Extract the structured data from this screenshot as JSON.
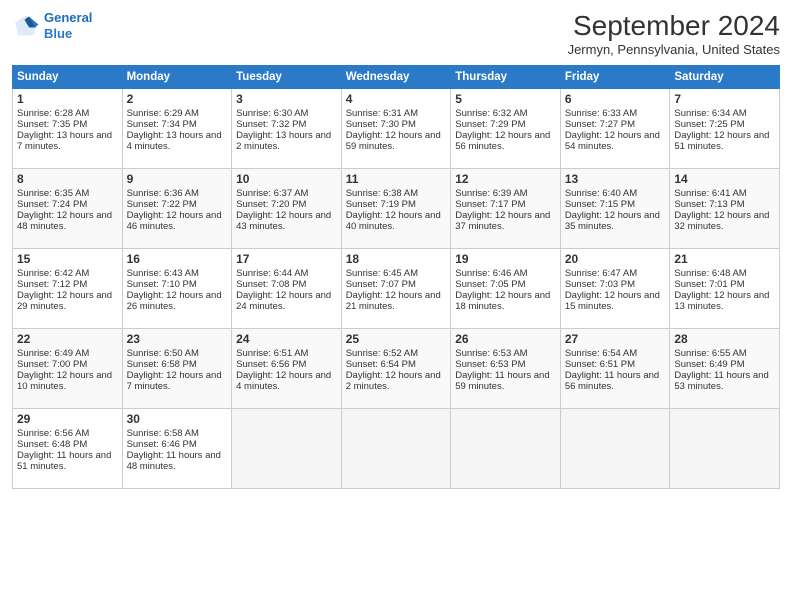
{
  "header": {
    "logo_line1": "General",
    "logo_line2": "Blue",
    "month_title": "September 2024",
    "subtitle": "Jermyn, Pennsylvania, United States"
  },
  "days_of_week": [
    "Sunday",
    "Monday",
    "Tuesday",
    "Wednesday",
    "Thursday",
    "Friday",
    "Saturday"
  ],
  "weeks": [
    [
      {
        "num": "1",
        "rise": "6:28 AM",
        "set": "7:35 PM",
        "daylight": "13 hours and 7 minutes."
      },
      {
        "num": "2",
        "rise": "6:29 AM",
        "set": "7:34 PM",
        "daylight": "13 hours and 4 minutes."
      },
      {
        "num": "3",
        "rise": "6:30 AM",
        "set": "7:32 PM",
        "daylight": "13 hours and 2 minutes."
      },
      {
        "num": "4",
        "rise": "6:31 AM",
        "set": "7:30 PM",
        "daylight": "12 hours and 59 minutes."
      },
      {
        "num": "5",
        "rise": "6:32 AM",
        "set": "7:29 PM",
        "daylight": "12 hours and 56 minutes."
      },
      {
        "num": "6",
        "rise": "6:33 AM",
        "set": "7:27 PM",
        "daylight": "12 hours and 54 minutes."
      },
      {
        "num": "7",
        "rise": "6:34 AM",
        "set": "7:25 PM",
        "daylight": "12 hours and 51 minutes."
      }
    ],
    [
      {
        "num": "8",
        "rise": "6:35 AM",
        "set": "7:24 PM",
        "daylight": "12 hours and 48 minutes."
      },
      {
        "num": "9",
        "rise": "6:36 AM",
        "set": "7:22 PM",
        "daylight": "12 hours and 46 minutes."
      },
      {
        "num": "10",
        "rise": "6:37 AM",
        "set": "7:20 PM",
        "daylight": "12 hours and 43 minutes."
      },
      {
        "num": "11",
        "rise": "6:38 AM",
        "set": "7:19 PM",
        "daylight": "12 hours and 40 minutes."
      },
      {
        "num": "12",
        "rise": "6:39 AM",
        "set": "7:17 PM",
        "daylight": "12 hours and 37 minutes."
      },
      {
        "num": "13",
        "rise": "6:40 AM",
        "set": "7:15 PM",
        "daylight": "12 hours and 35 minutes."
      },
      {
        "num": "14",
        "rise": "6:41 AM",
        "set": "7:13 PM",
        "daylight": "12 hours and 32 minutes."
      }
    ],
    [
      {
        "num": "15",
        "rise": "6:42 AM",
        "set": "7:12 PM",
        "daylight": "12 hours and 29 minutes."
      },
      {
        "num": "16",
        "rise": "6:43 AM",
        "set": "7:10 PM",
        "daylight": "12 hours and 26 minutes."
      },
      {
        "num": "17",
        "rise": "6:44 AM",
        "set": "7:08 PM",
        "daylight": "12 hours and 24 minutes."
      },
      {
        "num": "18",
        "rise": "6:45 AM",
        "set": "7:07 PM",
        "daylight": "12 hours and 21 minutes."
      },
      {
        "num": "19",
        "rise": "6:46 AM",
        "set": "7:05 PM",
        "daylight": "12 hours and 18 minutes."
      },
      {
        "num": "20",
        "rise": "6:47 AM",
        "set": "7:03 PM",
        "daylight": "12 hours and 15 minutes."
      },
      {
        "num": "21",
        "rise": "6:48 AM",
        "set": "7:01 PM",
        "daylight": "12 hours and 13 minutes."
      }
    ],
    [
      {
        "num": "22",
        "rise": "6:49 AM",
        "set": "7:00 PM",
        "daylight": "12 hours and 10 minutes."
      },
      {
        "num": "23",
        "rise": "6:50 AM",
        "set": "6:58 PM",
        "daylight": "12 hours and 7 minutes."
      },
      {
        "num": "24",
        "rise": "6:51 AM",
        "set": "6:56 PM",
        "daylight": "12 hours and 4 minutes."
      },
      {
        "num": "25",
        "rise": "6:52 AM",
        "set": "6:54 PM",
        "daylight": "12 hours and 2 minutes."
      },
      {
        "num": "26",
        "rise": "6:53 AM",
        "set": "6:53 PM",
        "daylight": "11 hours and 59 minutes."
      },
      {
        "num": "27",
        "rise": "6:54 AM",
        "set": "6:51 PM",
        "daylight": "11 hours and 56 minutes."
      },
      {
        "num": "28",
        "rise": "6:55 AM",
        "set": "6:49 PM",
        "daylight": "11 hours and 53 minutes."
      }
    ],
    [
      {
        "num": "29",
        "rise": "6:56 AM",
        "set": "6:48 PM",
        "daylight": "11 hours and 51 minutes."
      },
      {
        "num": "30",
        "rise": "6:58 AM",
        "set": "6:46 PM",
        "daylight": "11 hours and 48 minutes."
      },
      null,
      null,
      null,
      null,
      null
    ]
  ]
}
